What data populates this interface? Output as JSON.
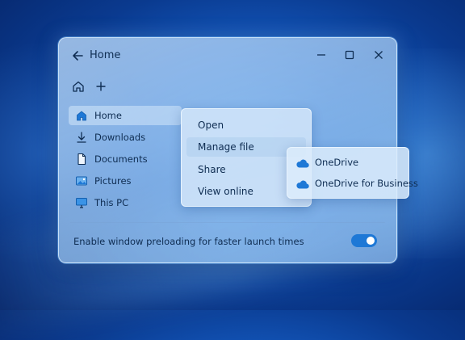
{
  "window": {
    "title": "Home",
    "controls": {
      "minimize": "minimize-icon",
      "maximize": "maximize-icon",
      "close": "close-icon"
    }
  },
  "toolbar": {
    "home_icon": "home-icon",
    "add_icon": "plus-icon"
  },
  "sidebar": {
    "items": [
      {
        "label": "Home",
        "icon": "home-icon",
        "selected": true
      },
      {
        "label": "Downloads",
        "icon": "download-icon",
        "selected": false
      },
      {
        "label": "Documents",
        "icon": "document-icon",
        "selected": false
      },
      {
        "label": "Pictures",
        "icon": "picture-icon",
        "selected": false
      },
      {
        "label": "This PC",
        "icon": "monitor-icon",
        "selected": false
      }
    ]
  },
  "context_menu": {
    "items": [
      {
        "label": "Open"
      },
      {
        "label": "Manage file",
        "highlighted": true
      },
      {
        "label": "Share"
      },
      {
        "label": "View online"
      }
    ],
    "submenu": [
      {
        "label": "OneDrive",
        "icon": "cloud-icon"
      },
      {
        "label": "OneDrive for Business",
        "icon": "cloud-icon"
      }
    ]
  },
  "footer": {
    "setting_label": "Enable window preloading for faster launch times",
    "toggle_on": true
  },
  "colors": {
    "accent": "#1e78d6",
    "text": "#0f2d52",
    "cloud": "#1e78d6"
  }
}
